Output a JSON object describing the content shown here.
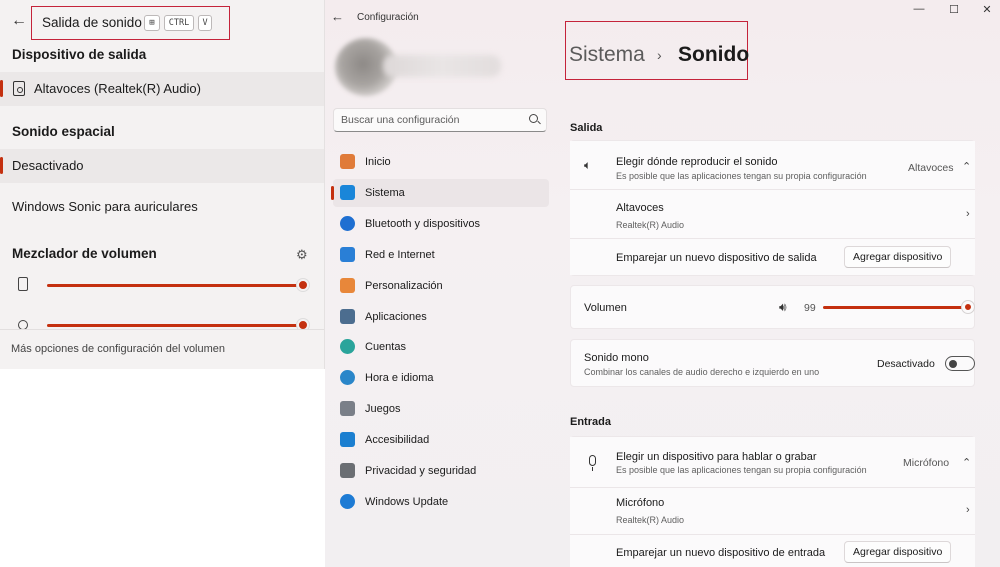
{
  "flyout": {
    "back_icon": "arrow-left-icon",
    "title": "Salida de sonido",
    "shortcut": {
      "win": "⊞",
      "ctrl": "CTRL",
      "v": "V"
    },
    "output_header": "Dispositivo de salida",
    "output_device": "Altavoces (Realtek(R) Audio)",
    "spatial_header": "Sonido espacial",
    "spatial_options": [
      "Desactivado",
      "Windows Sonic para auriculares"
    ],
    "mixer_header": "Mezclador de volumen",
    "mixer_levels": [
      1.0,
      1.0
    ],
    "more_options": "Más opciones de configuración del volumen",
    "accent_color": "#c4300f"
  },
  "window": {
    "title": "Configuración",
    "controls": {
      "minimize": "—",
      "maximize": "☐",
      "close": "✕"
    },
    "search_placeholder": "Buscar una configuración",
    "nav": [
      {
        "label": "Inicio",
        "icon": "home-icon",
        "color": "#e07b39"
      },
      {
        "label": "Sistema",
        "icon": "system-icon",
        "color": "#1a86d9"
      },
      {
        "label": "Bluetooth y dispositivos",
        "icon": "bluetooth-icon",
        "color": "#1f6fd1"
      },
      {
        "label": "Red e Internet",
        "icon": "wifi-icon",
        "color": "#2a7fd6"
      },
      {
        "label": "Personalización",
        "icon": "brush-icon",
        "color": "#e8873a"
      },
      {
        "label": "Aplicaciones",
        "icon": "apps-icon",
        "color": "#4c6d8f"
      },
      {
        "label": "Cuentas",
        "icon": "account-icon",
        "color": "#2aa49b"
      },
      {
        "label": "Hora e idioma",
        "icon": "globe-clock-icon",
        "color": "#2a86c9"
      },
      {
        "label": "Juegos",
        "icon": "gamepad-icon",
        "color": "#7a7f88"
      },
      {
        "label": "Accesibilidad",
        "icon": "accessibility-icon",
        "color": "#1b7fd0"
      },
      {
        "label": "Privacidad y seguridad",
        "icon": "shield-icon",
        "color": "#6b6e73"
      },
      {
        "label": "Windows Update",
        "icon": "update-icon",
        "color": "#1e7bd4"
      }
    ],
    "active_nav": "Sistema",
    "breadcrumb": {
      "parent": "Sistema",
      "separator": "›",
      "current": "Sonido"
    },
    "salida": {
      "header": "Salida",
      "choose_title": "Elegir dónde reproducir el sonido",
      "choose_sub": "Es posible que las aplicaciones tengan su propia configuración",
      "choose_value": "Altavoces",
      "device_title": "Altavoces",
      "device_sub": "Realtek(R) Audio",
      "pair_label": "Emparejar un nuevo dispositivo de salida",
      "pair_button": "Agregar dispositivo",
      "volume_label": "Volumen",
      "volume_value": "99",
      "volume_level": 0.99,
      "mono_title": "Sonido mono",
      "mono_sub": "Combinar los canales de audio derecho e izquierdo en uno",
      "mono_state": "Desactivado"
    },
    "entrada": {
      "header": "Entrada",
      "choose_title": "Elegir un dispositivo para hablar o grabar",
      "choose_sub": "Es posible que las aplicaciones tengan su propia configuración",
      "choose_value": "Micrófono",
      "device_title": "Micrófono",
      "device_sub": "Realtek(R) Audio",
      "pair_label": "Emparejar un nuevo dispositivo de entrada",
      "pair_button": "Agregar dispositivo"
    }
  }
}
